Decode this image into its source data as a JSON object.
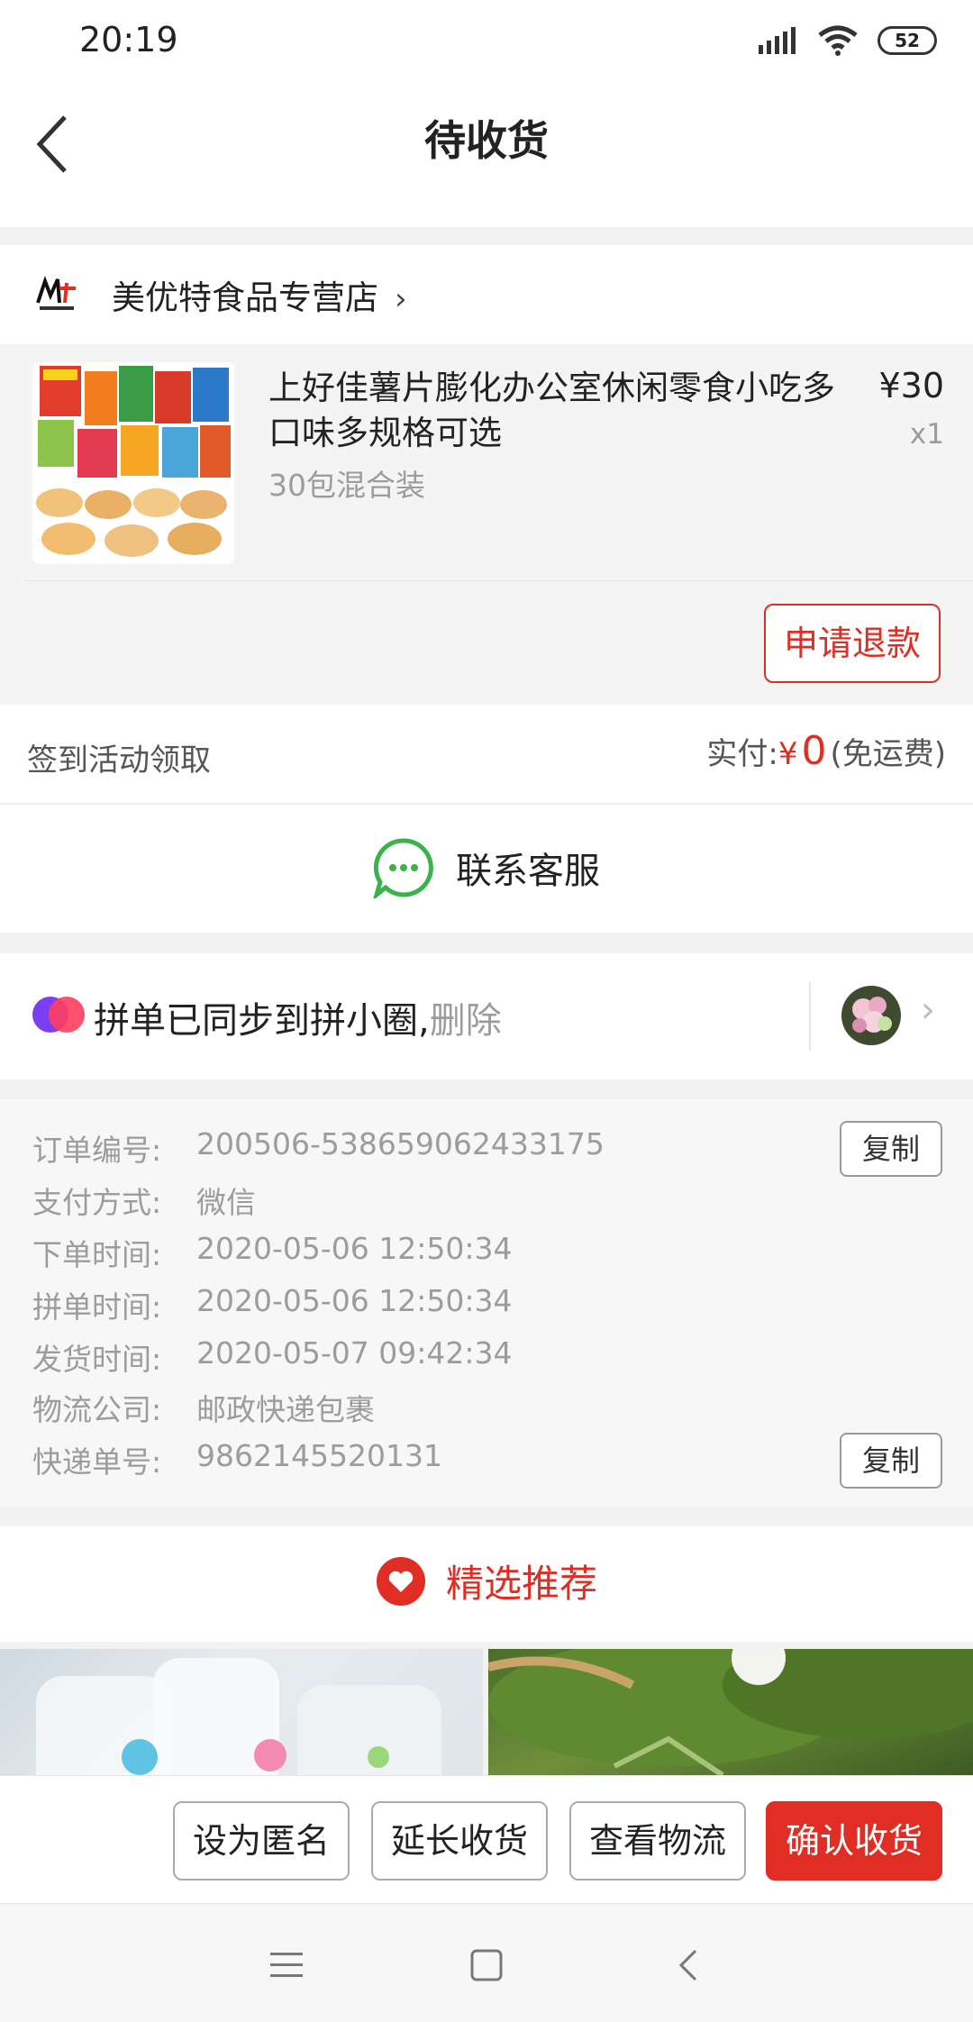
{
  "status_bar": {
    "time": "20:19",
    "battery": "52"
  },
  "header": {
    "title": "待收货"
  },
  "store": {
    "name": "美优特食品专营店",
    "arrow": "›"
  },
  "goods": {
    "title": "上好佳薯片膨化办公室休闲零食小吃多口味多规格可选",
    "spec": "30包混合装",
    "price": "¥30",
    "quantity": "x1",
    "refund_label": "申请退款"
  },
  "payment": {
    "left_label": "签到活动领取",
    "paid_label": "实付:",
    "currency": "¥",
    "amount": "0",
    "shipping_note": "(免运费)"
  },
  "customer_service": {
    "label": "联系客服"
  },
  "group_sync": {
    "text": "拼单已同步到拼小圈,",
    "delete_label": "删除",
    "arrow": "›"
  },
  "order_info": {
    "copy_label": "复制",
    "rows": [
      {
        "key": "订单编号:",
        "value": "200506-538659062433175"
      },
      {
        "key": "支付方式:",
        "value": "微信"
      },
      {
        "key": "下单时间:",
        "value": "2020-05-06 12:50:34"
      },
      {
        "key": "拼单时间:",
        "value": "2020-05-06 12:50:34"
      },
      {
        "key": "发货时间:",
        "value": "2020-05-07 09:42:34"
      },
      {
        "key": "物流公司:",
        "value": "邮政快递包裹"
      },
      {
        "key": "快递单号:",
        "value": "9862145520131"
      }
    ]
  },
  "recommend": {
    "title": "精选推荐"
  },
  "actions": {
    "anonymous": "设为匿名",
    "extend": "延长收货",
    "logistics": "查看物流",
    "confirm": "确认收货"
  },
  "colors": {
    "accent": "#e02e24",
    "cs_green": "#3bb24a"
  },
  "icons": {
    "back": "back-arrow-icon",
    "chat": "chat-bubble-icon",
    "heart": "heart-badge-icon",
    "nav_menu": "menu-icon",
    "nav_home": "home-square-icon",
    "nav_back": "nav-back-icon"
  }
}
